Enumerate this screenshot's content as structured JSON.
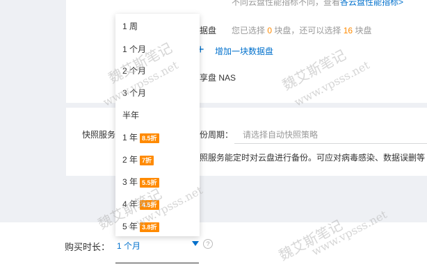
{
  "top": {
    "perf_text": "不同云盘性能指标不同，查看",
    "perf_link": "各云盘性能指标>",
    "disk_label": "据盘",
    "disk_selected_prefix": "您已选择",
    "disk_selected_count": "0",
    "disk_selected_mid": "块盘，还可以选择",
    "disk_remaining_count": "16",
    "disk_selected_suffix": "块盘",
    "add_disk_label": "增加一块数据盘",
    "nas_label": "享盘 NAS"
  },
  "snapshot": {
    "section_label": "快照服务",
    "period_label": "份周期：",
    "period_placeholder": "请选择自动快照策略",
    "desc": "照服务能定时对云盘进行备份。可应对病毒感染、数据误删等"
  },
  "purchase": {
    "label": "购买时长：",
    "selected": "1 个月",
    "help_icon": "?"
  },
  "dropdown": {
    "options": [
      {
        "label": "1 周",
        "badge": ""
      },
      {
        "label": "1 个月",
        "badge": ""
      },
      {
        "label": "2 个月",
        "badge": ""
      },
      {
        "label": "3 个月",
        "badge": ""
      },
      {
        "label": "半年",
        "badge": ""
      },
      {
        "label": "1 年",
        "badge": "8.5折"
      },
      {
        "label": "2 年",
        "badge": "7折"
      },
      {
        "label": "3 年",
        "badge": "5.5折"
      },
      {
        "label": "4 年",
        "badge": "4.5折"
      },
      {
        "label": "5 年",
        "badge": "3.8折"
      }
    ]
  },
  "watermark": {
    "text_cn": "魏艾斯笔记",
    "text_url": "www.vpsss.net"
  },
  "colors": {
    "accent": "#0070cc",
    "orange": "#ff8a00",
    "page_bg": "#eef0f4"
  }
}
